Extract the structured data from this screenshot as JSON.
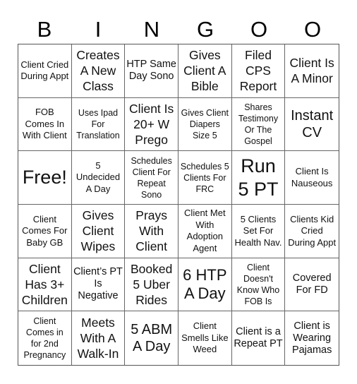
{
  "header": [
    "B",
    "I",
    "N",
    "G",
    "O",
    "O"
  ],
  "cells": [
    {
      "text": "Client Cried During Appt",
      "size": "s13"
    },
    {
      "text": "Creates A New Class",
      "size": "s17"
    },
    {
      "text": "HTP Same Day Sono",
      "size": "s14"
    },
    {
      "text": "Gives Client A Bible",
      "size": "s17"
    },
    {
      "text": "Filed CPS Report",
      "size": "s17"
    },
    {
      "text": "Client Is A Minor",
      "size": "s17"
    },
    {
      "text": "FOB Comes In With Client",
      "size": "s13"
    },
    {
      "text": "Uses Ipad For Translation",
      "size": "s12"
    },
    {
      "text": "Client Is 20+ W Prego",
      "size": "s17"
    },
    {
      "text": "Gives Client Diapers Size 5",
      "size": "s12"
    },
    {
      "text": "Shares Testimony Or The Gospel",
      "size": "s12"
    },
    {
      "text": "Instant CV",
      "size": "s20"
    },
    {
      "text": "Free!",
      "size": "s27"
    },
    {
      "text": "5 Undecided A Day",
      "size": "s13"
    },
    {
      "text": "Schedules Client For Repeat Sono",
      "size": "s12"
    },
    {
      "text": "Schedules 5 Clients For FRC",
      "size": "s12"
    },
    {
      "text": "Run 5 PT",
      "size": "s27"
    },
    {
      "text": "Client Is Nauseous",
      "size": "s13"
    },
    {
      "text": "Client Comes For Baby GB",
      "size": "s13"
    },
    {
      "text": "Gives Client Wipes",
      "size": "s17"
    },
    {
      "text": "Prays With Client",
      "size": "s17"
    },
    {
      "text": "Client Met With Adoption Agent",
      "size": "s13"
    },
    {
      "text": "5 Clients Set For Health Nav.",
      "size": "s13"
    },
    {
      "text": "Clients Kid Cried During Appt",
      "size": "s13"
    },
    {
      "text": "Client Has 3+ Children",
      "size": "s17"
    },
    {
      "text": "Client’s PT Is Negative",
      "size": "s14"
    },
    {
      "text": "Booked 5 Uber Rides",
      "size": "s17"
    },
    {
      "text": "6 HTP A Day",
      "size": "s22"
    },
    {
      "text": "Client Doesn't Know Who FOB Is",
      "size": "s12"
    },
    {
      "text": "Covered For FD",
      "size": "s14"
    },
    {
      "text": "Client Comes in for 2nd Pregnancy",
      "size": "s12"
    },
    {
      "text": "Meets With A Walk-In",
      "size": "s17"
    },
    {
      "text": "5 ABM A Day",
      "size": "s20"
    },
    {
      "text": "Client Smells Like Weed",
      "size": "s13"
    },
    {
      "text": "Client is a Repeat PT",
      "size": "s14"
    },
    {
      "text": "Client is Wearing Pajamas",
      "size": "s14"
    }
  ]
}
